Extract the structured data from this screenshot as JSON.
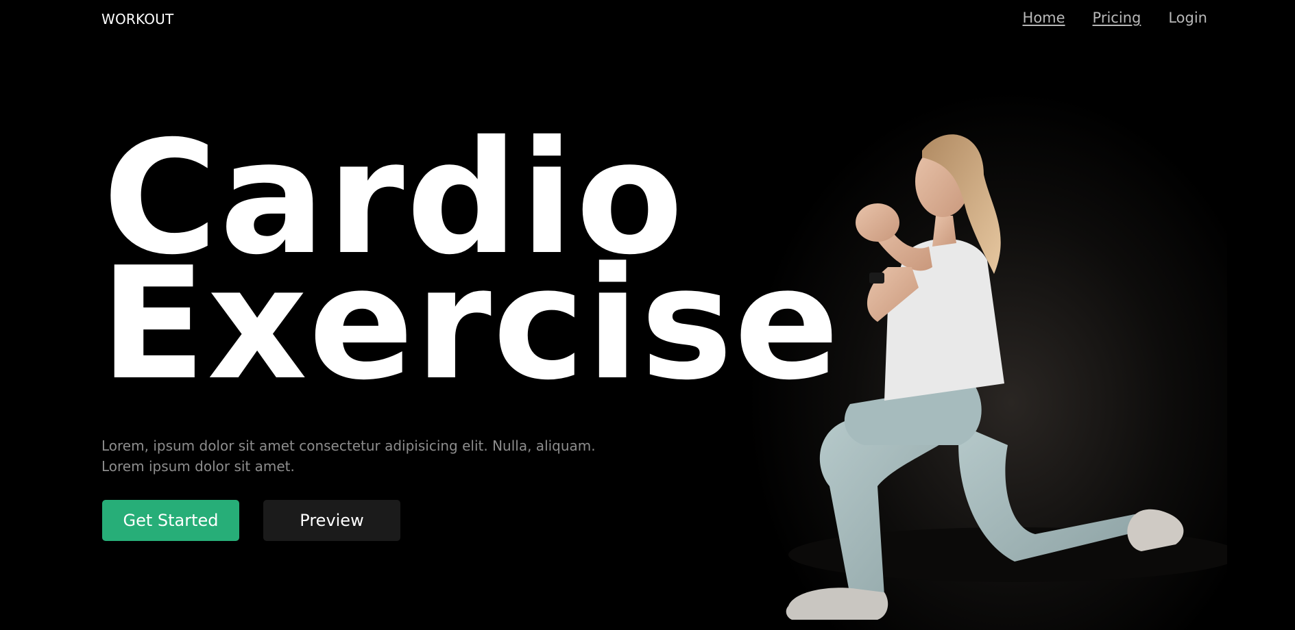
{
  "brand": {
    "logo_text": "WORKOUT"
  },
  "nav": {
    "items": [
      {
        "label": "Home",
        "underlined": true
      },
      {
        "label": "Pricing",
        "underlined": true
      },
      {
        "label": "Login",
        "underlined": false
      }
    ]
  },
  "hero": {
    "title_line1": "Cardio",
    "title_line2": "Exercise",
    "description_line1": "Lorem, ipsum dolor sit amet consectetur adipisicing elit. Nulla, aliquam.",
    "description_line2": "Lorem ipsum dolor sit amet.",
    "primary_button": "Get Started",
    "secondary_button": "Preview",
    "image_subject": "woman-lunge-photo"
  },
  "colors": {
    "background": "#000000",
    "primary_accent": "#27ae78",
    "secondary_button": "#1b1b1b",
    "muted_text": "#8d8d8d",
    "nav_text": "#b9b9b9"
  }
}
